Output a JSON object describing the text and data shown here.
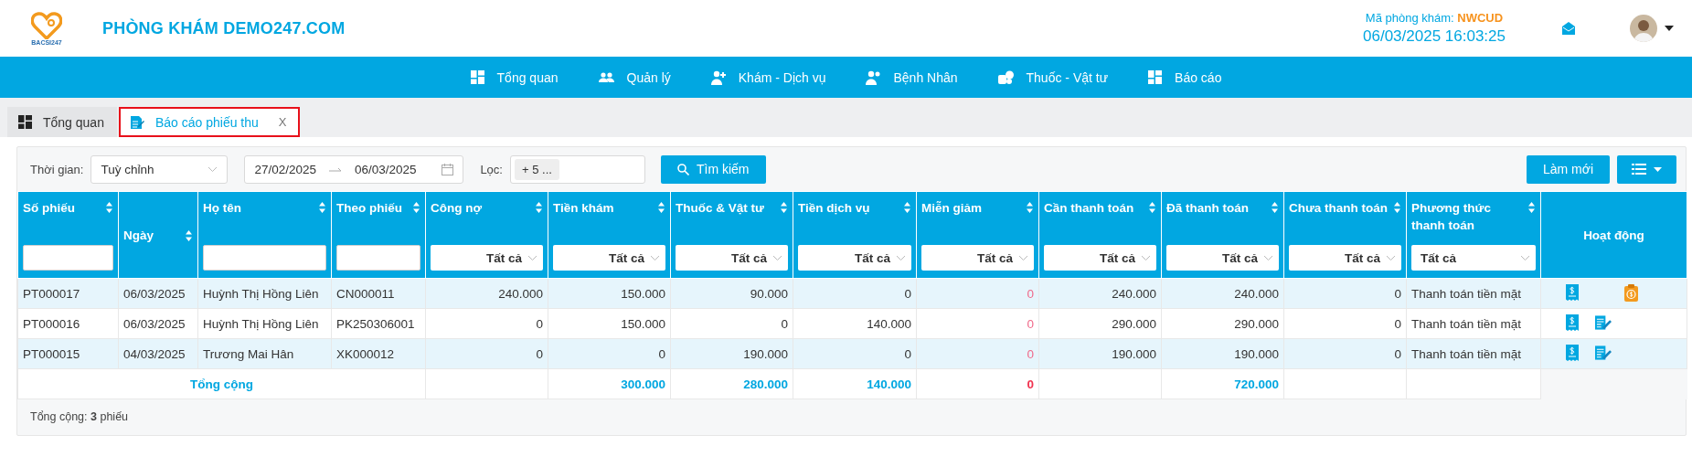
{
  "header": {
    "logo_text": "BACSI247",
    "clinic_name": "PHÒNG KHÁM DEMO247.COM",
    "clinic_code_label": "Mã phòng khám:",
    "clinic_code": "NWCUD",
    "datetime": "06/03/2025 16:03:25"
  },
  "nav": [
    {
      "label": "Tổng quan"
    },
    {
      "label": "Quản lý"
    },
    {
      "label": "Khám - Dịch vụ"
    },
    {
      "label": "Bệnh Nhân"
    },
    {
      "label": "Thuốc - Vật tư"
    },
    {
      "label": "Báo cáo"
    }
  ],
  "tabs": [
    {
      "label": "Tổng quan",
      "selected": false
    },
    {
      "label": "Báo cáo phiếu thu",
      "selected": true,
      "close": "X"
    }
  ],
  "filters": {
    "time_label": "Thời gian:",
    "time_value": "Tuỳ chỉnh",
    "date_from": "27/02/2025",
    "date_to": "06/03/2025",
    "filter_label": "Lọc:",
    "filter_chip": "+ 5 ...",
    "search_button": "Tìm kiếm",
    "refresh_button": "Làm mới"
  },
  "table": {
    "columns": [
      {
        "label": "Số phiếu",
        "kind": "text",
        "filter": {
          "kind": "text"
        }
      },
      {
        "label": "Ngày",
        "kind": "text"
      },
      {
        "label": "Họ tên",
        "kind": "text",
        "filter": {
          "kind": "text"
        }
      },
      {
        "label": "Theo phiếu",
        "kind": "text",
        "filter": {
          "kind": "text"
        }
      },
      {
        "label": "Công nợ",
        "kind": "number",
        "filter": {
          "kind": "select",
          "value": "Tất cả"
        }
      },
      {
        "label": "Tiền khám",
        "kind": "number",
        "filter": {
          "kind": "select",
          "value": "Tất cả"
        }
      },
      {
        "label": "Thuốc & Vật tư",
        "kind": "number",
        "filter": {
          "kind": "select",
          "value": "Tất cả"
        }
      },
      {
        "label": "Tiền dịch vụ",
        "kind": "number",
        "filter": {
          "kind": "select",
          "value": "Tất cả"
        }
      },
      {
        "label": "Miễn giảm",
        "kind": "discount",
        "filter": {
          "kind": "select",
          "value": "Tất cả"
        }
      },
      {
        "label": "Cần thanh toán",
        "kind": "number",
        "filter": {
          "kind": "select",
          "value": "Tất cả"
        }
      },
      {
        "label": "Đã thanh toán",
        "kind": "number",
        "filter": {
          "kind": "select",
          "value": "Tất cả"
        }
      },
      {
        "label": "Chưa thanh toán",
        "kind": "number",
        "filter": {
          "kind": "select",
          "value": "Tất cả"
        }
      },
      {
        "label": "Phương thức thanh toán",
        "kind": "text",
        "filter": {
          "kind": "select",
          "value": "Tất cả"
        }
      },
      {
        "label": "Hoạt động",
        "kind": "actions"
      }
    ],
    "rows": [
      {
        "cells": [
          "PT000017",
          "06/03/2025",
          "Huỳnh Thị Hồng Liên",
          "CN000011",
          "240.000",
          "150.000",
          "90.000",
          "0",
          "0",
          "240.000",
          "240.000",
          "0",
          "Thanh toán tiền mặt"
        ],
        "actions": [
          {
            "kind": "receipt"
          },
          {
            "kind": "empty"
          },
          {
            "kind": "refund"
          }
        ]
      },
      {
        "cells": [
          "PT000016",
          "06/03/2025",
          "Huỳnh Thị Hồng Liên",
          "PK250306001",
          "0",
          "150.000",
          "0",
          "140.000",
          "0",
          "290.000",
          "290.000",
          "0",
          "Thanh toán tiền mặt"
        ],
        "actions": [
          {
            "kind": "receipt"
          },
          {
            "kind": "edit"
          }
        ]
      },
      {
        "cells": [
          "PT000015",
          "04/03/2025",
          "Trương Mai Hân",
          "XK000012",
          "0",
          "0",
          "190.000",
          "0",
          "0",
          "190.000",
          "190.000",
          "0",
          "Thanh toán tiền mặt"
        ],
        "actions": [
          {
            "kind": "receipt"
          },
          {
            "kind": "edit"
          }
        ]
      }
    ],
    "total_label": "Tổng cộng",
    "totals": [
      {
        "kind": "blank"
      },
      {
        "kind": "value",
        "value": "300.000"
      },
      {
        "kind": "value",
        "value": "280.000"
      },
      {
        "kind": "value",
        "value": "140.000"
      },
      {
        "kind": "value",
        "value": "0"
      },
      {
        "kind": "blank"
      },
      {
        "kind": "value",
        "value": "720.000"
      },
      {
        "kind": "blank"
      },
      {
        "kind": "blank"
      }
    ]
  },
  "summary": {
    "label": "Tổng cộng:",
    "count": "3",
    "unit": "phiếu"
  }
}
